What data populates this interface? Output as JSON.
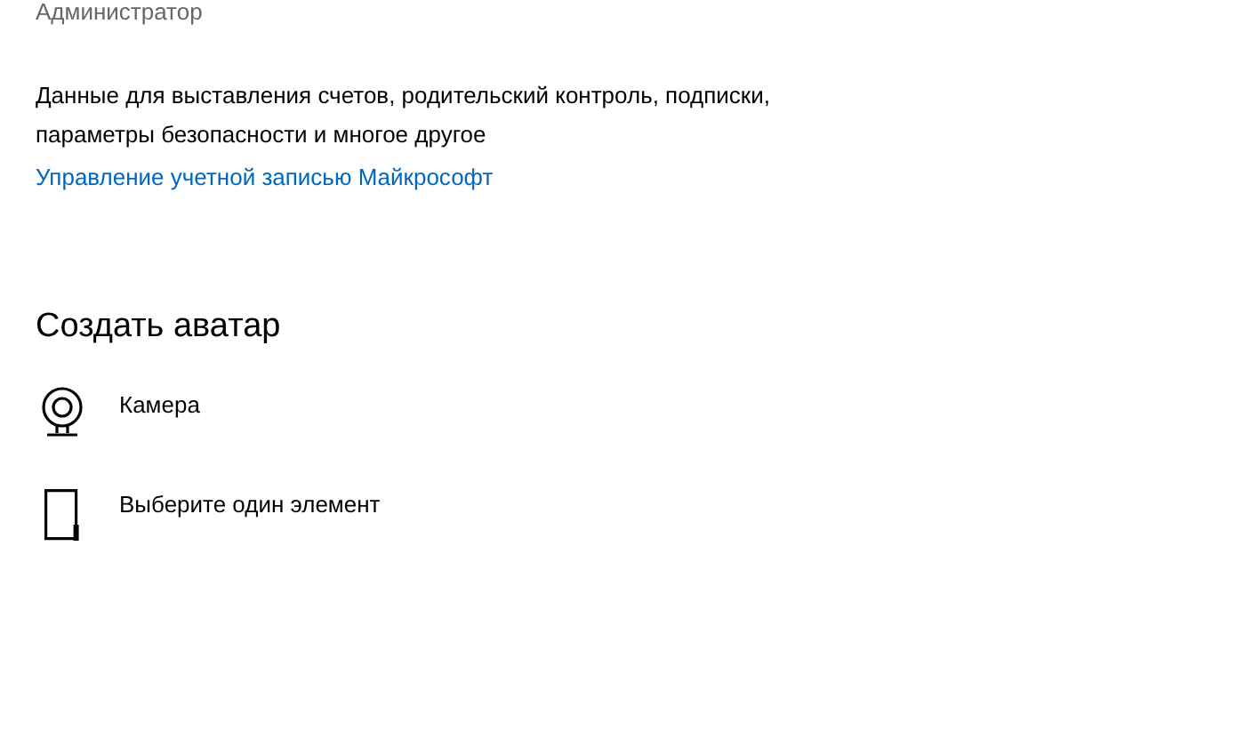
{
  "account": {
    "role": "Администратор",
    "description": "Данные для выставления счетов, родительский контроль, подписки, параметры безопасности и многое другое",
    "link": "Управление учетной записью Майкрософт"
  },
  "avatar": {
    "heading": "Создать аватар",
    "options": [
      {
        "kind": "camera",
        "label": "Камера"
      },
      {
        "kind": "file",
        "label": "Выберите один элемент"
      }
    ]
  }
}
